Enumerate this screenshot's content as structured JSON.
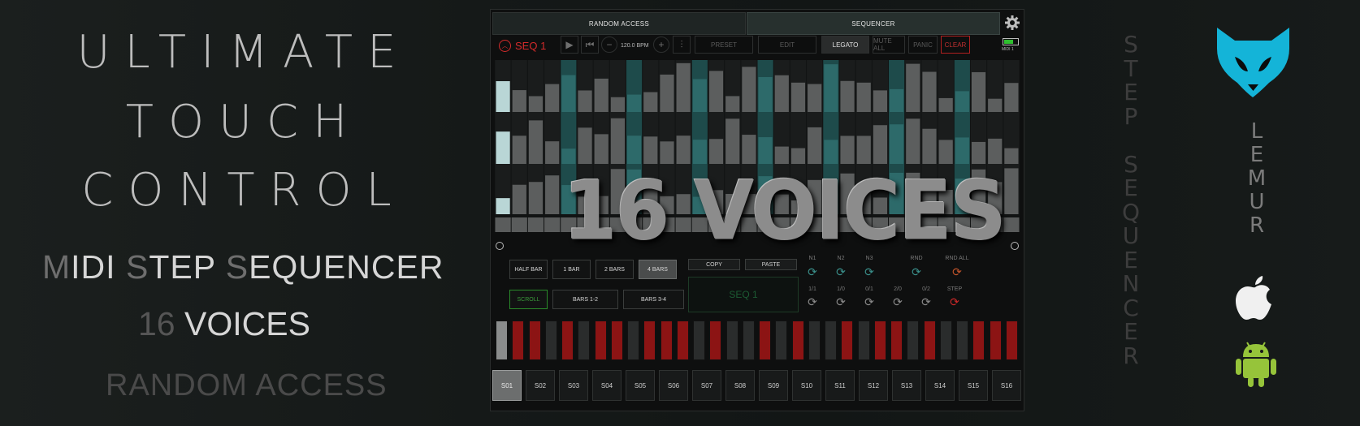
{
  "promo": {
    "title": [
      "ULTIMATE",
      "TOUCH",
      "CONTROL"
    ],
    "midi_line": {
      "m": "M",
      "idi": "IDI ",
      "s1": "S",
      "tep": "TEP ",
      "s2": "S",
      "equencer": "EQUENCER"
    },
    "voices_line": {
      "num": "16",
      "word": " VOICES"
    },
    "random_access": "RANDOM ACCESS",
    "step_sequencer_vertical": "STEP SEQUENCER",
    "lemur_vertical": "LEMUR"
  },
  "app": {
    "tabs": [
      "RANDOM ACCESS",
      "SEQUENCER"
    ],
    "toolbar": {
      "seq_label": "SEQ 1",
      "bpm": "120.0 BPM",
      "preset": "PRESET",
      "edit": "EDIT",
      "legato": "LEGATO",
      "mute_all": "MUTE ALL",
      "panic": "PANIC",
      "clear": "CLEAR",
      "midi": "MIDI 1",
      "battery_level": 0.7
    },
    "overlay_text": "16 VOICES",
    "bar_buttons": [
      "HALF BAR",
      "1 BAR",
      "2 BARS",
      "4 BARS"
    ],
    "scroll_buttons": [
      "SCROLL",
      "BARS 1-2",
      "BARS 3-4"
    ],
    "copy_label": "COPY",
    "paste_label": "PASTE",
    "seq_display": "SEQ 1",
    "random_labels_row1": [
      "N1",
      "N2",
      "N3",
      "RND",
      "RND ALL"
    ],
    "random_labels_row2": [
      "1/1",
      "1/0",
      "0/1",
      "2/0",
      "0/2",
      "STEP"
    ],
    "slots": [
      "S01",
      "S02",
      "S03",
      "S04",
      "S05",
      "S06",
      "S07",
      "S08",
      "S09",
      "S10",
      "S11",
      "S12",
      "S13",
      "S14",
      "S15",
      "S16"
    ],
    "active_slot": "S01",
    "colors": {
      "accent_red": "#d32b2b",
      "accent_green": "#2a8a2a",
      "teal": "#1e4b4b"
    }
  }
}
